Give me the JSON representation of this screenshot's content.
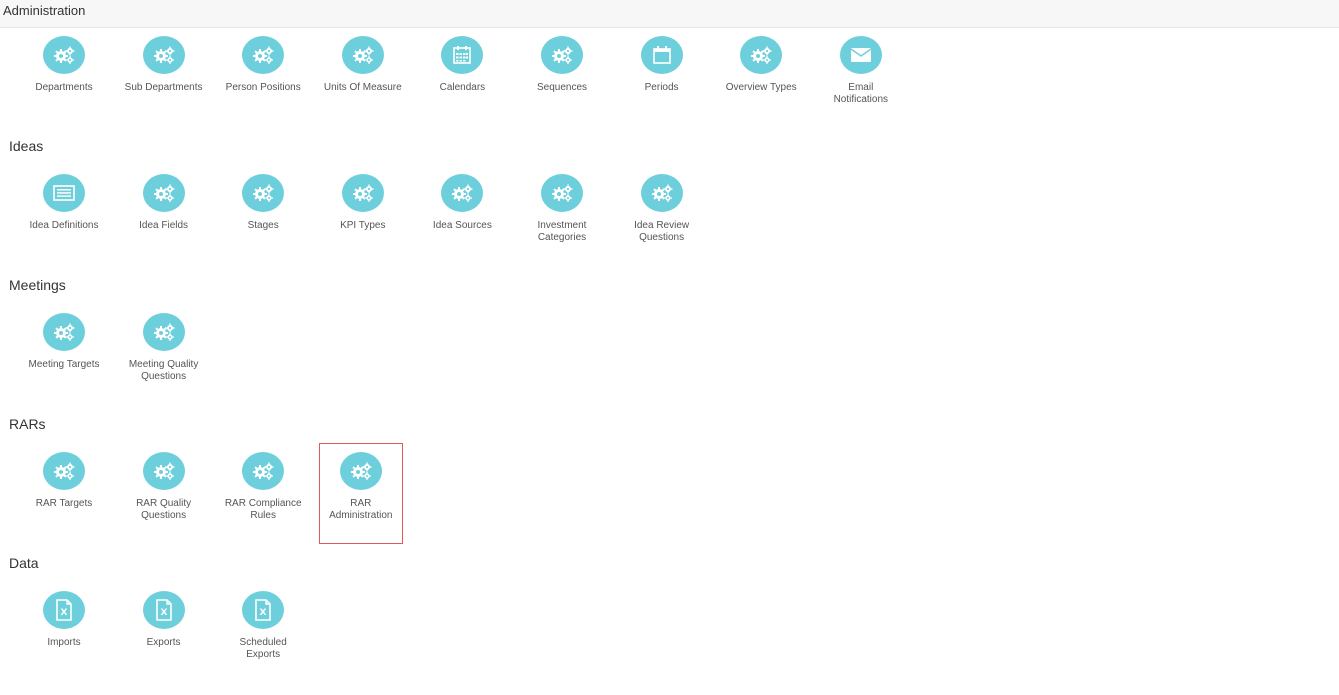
{
  "page": {
    "title": "Administration"
  },
  "colors": {
    "icon_bg": "#6dcfdc",
    "selected_border": "#e05a5a"
  },
  "sections": [
    {
      "title": "",
      "items": [
        {
          "label": "Departments",
          "icon": "gears-icon"
        },
        {
          "label": "Sub Departments",
          "icon": "gears-icon"
        },
        {
          "label": "Person Positions",
          "icon": "gears-icon"
        },
        {
          "label": "Units Of Measure",
          "icon": "gears-icon"
        },
        {
          "label": "Calendars",
          "icon": "calendar-grid-icon"
        },
        {
          "label": "Sequences",
          "icon": "gears-icon"
        },
        {
          "label": "Periods",
          "icon": "calendar-icon"
        },
        {
          "label": "Overview Types",
          "icon": "gears-icon"
        },
        {
          "label": "Email Notifications",
          "icon": "envelope-icon"
        }
      ]
    },
    {
      "title": "Ideas",
      "items": [
        {
          "label": "Idea Definitions",
          "icon": "list-icon"
        },
        {
          "label": "Idea Fields",
          "icon": "gears-icon"
        },
        {
          "label": "Stages",
          "icon": "gears-icon"
        },
        {
          "label": "KPI Types",
          "icon": "gears-icon"
        },
        {
          "label": "Idea Sources",
          "icon": "gears-icon"
        },
        {
          "label": "Investment Categories",
          "icon": "gears-icon"
        },
        {
          "label": "Idea Review Questions",
          "icon": "gears-icon"
        }
      ]
    },
    {
      "title": "Meetings",
      "items": [
        {
          "label": "Meeting Targets",
          "icon": "gears-icon"
        },
        {
          "label": "Meeting Quality Questions",
          "icon": "gears-icon"
        }
      ]
    },
    {
      "title": "RARs",
      "items": [
        {
          "label": "RAR Targets",
          "icon": "gears-icon"
        },
        {
          "label": "RAR Quality Questions",
          "icon": "gears-icon"
        },
        {
          "label": "RAR Compliance Rules",
          "icon": "gears-icon"
        },
        {
          "label": "RAR Administration",
          "icon": "gears-icon",
          "selected": true
        }
      ]
    },
    {
      "title": "Data",
      "items": [
        {
          "label": "Imports",
          "icon": "excel-file-icon"
        },
        {
          "label": "Exports",
          "icon": "excel-file-icon"
        },
        {
          "label": "Scheduled Exports",
          "icon": "excel-file-icon"
        }
      ]
    }
  ]
}
